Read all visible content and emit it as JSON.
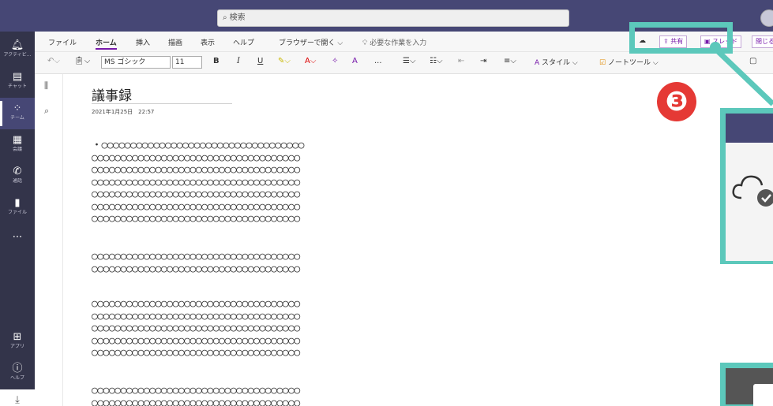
{
  "search": {
    "placeholder": "検索"
  },
  "rail": [
    {
      "label": "アクティビ..."
    },
    {
      "label": "チャット"
    },
    {
      "label": "チーム"
    },
    {
      "label": "会議"
    },
    {
      "label": "通話"
    },
    {
      "label": "ファイル"
    },
    {
      "label": "..."
    },
    {
      "label": "アプリ"
    },
    {
      "label": "ヘルプ"
    }
  ],
  "menu": {
    "items": [
      "ファイル",
      "ホーム",
      "挿入",
      "描画",
      "表示",
      "ヘルプ"
    ],
    "open_in_browser": "ブラウザーで開く",
    "tell_me": "必要な作業を入力",
    "share": "共有",
    "thread": "スレッド",
    "close": "閉じる"
  },
  "toolbar": {
    "font": "MS ゴシック",
    "size": "11",
    "bold": "B",
    "italic": "I",
    "underline": "U",
    "styles": "スタイル",
    "note_tools": "ノートツール",
    "more": "..."
  },
  "page": {
    "title": "議事録",
    "date": "2021年1月25日　22:57",
    "paragraphs": [
      [
        "・○○○○○○○○○○○○○○○○○○○○○○○○○○○○○○○○○○○",
        "○○○○○○○○○○○○○○○○○○○○○○○○○○○○○○○○○○○○",
        "○○○○○○○○○○○○○○○○○○○○○○○○○○○○○○○○○○○○",
        "○○○○○○○○○○○○○○○○○○○○○○○○○○○○○○○○○○○○",
        "○○○○○○○○○○○○○○○○○○○○○○○○○○○○○○○○○○○○",
        "○○○○○○○○○○○○○○○○○○○○○○○○○○○○○○○○○○○○",
        "○○○○○○○○○○○○○○○○○○○○○○○○○○○○○○○○○○○○"
      ],
      [
        "○○○○○○○○○○○○○○○○○○○○○○○○○○○○○○○○○○○○",
        "○○○○○○○○○○○○○○○○○○○○○○○○○○○○○○○○○○○○"
      ],
      [
        "○○○○○○○○○○○○○○○○○○○○○○○○○○○○○○○○○○○○",
        "○○○○○○○○○○○○○○○○○○○○○○○○○○○○○○○○○○○○",
        "○○○○○○○○○○○○○○○○○○○○○○○○○○○○○○○○○○○○",
        "○○○○○○○○○○○○○○○○○○○○○○○○○○○○○○○○○○○○",
        "○○○○○○○○○○○○○○○○○○○○○○○○○○○○○○○○○○○○"
      ],
      [
        "○○○○○○○○○○○○○○○○○○○○○○○○○○○○○○○○○○○○",
        "○○○○○○○○○○○○○○○○○○○○○○○○○○○○○○○○○○○○"
      ]
    ]
  },
  "annotation": {
    "step": "❸",
    "highlight_color": "#5cc8bb",
    "badge_color": "#e53935"
  },
  "colors": {
    "teams_purple": "#464775",
    "rail": "#33344a",
    "accent": "#7719aa"
  }
}
